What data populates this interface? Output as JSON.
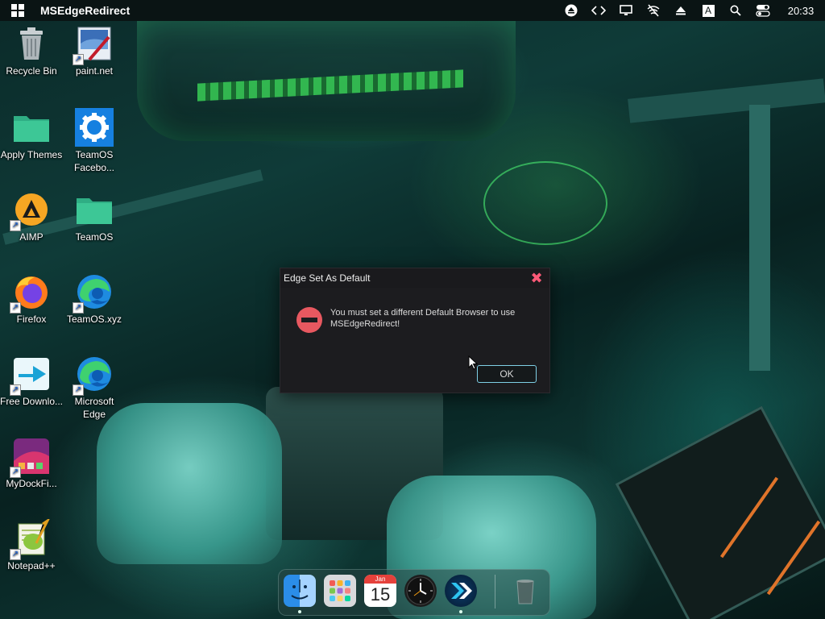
{
  "topbar": {
    "title": "MSEdgeRedirect",
    "clock": "20:33",
    "tray_icons": [
      "eject-circle-icon",
      "code-brackets-icon",
      "monitor-icon",
      "wifi-off-icon",
      "eject-icon",
      "keyboard-layout-icon",
      "search-icon",
      "toggle-icon"
    ],
    "keyboard_letter": "A"
  },
  "desktop": {
    "icons": [
      {
        "label": "Recycle Bin",
        "icon": "recycle-bin-icon"
      },
      {
        "label": "paint.net",
        "icon": "paintnet-icon"
      },
      {
        "label": "Apply Themes",
        "icon": "folder-icon"
      },
      {
        "label": "TeamOS Facebo...",
        "icon": "gear-icon"
      },
      {
        "label": "AIMP",
        "icon": "aimp-icon"
      },
      {
        "label": "TeamOS",
        "icon": "folder-icon"
      },
      {
        "label": "Firefox",
        "icon": "firefox-icon"
      },
      {
        "label": "TeamOS.xyz",
        "icon": "edge-icon"
      },
      {
        "label": "Free Downlo...",
        "icon": "download-arrow-icon"
      },
      {
        "label": "Microsoft Edge",
        "icon": "edge-icon"
      },
      {
        "label": "MyDockFi...",
        "icon": "mydock-icon"
      },
      {
        "label": "Notepad++",
        "icon": "notepadpp-icon"
      }
    ]
  },
  "dialog": {
    "title": "Edge Set As Default",
    "message": "You must set a different Default Browser to use MSEdgeRedirect!",
    "ok_label": "OK",
    "close_glyph": "✖"
  },
  "dock": {
    "calendar_month": "Jan",
    "calendar_day": "15",
    "items": [
      "finder-icon",
      "launchpad-icon",
      "calendar-icon",
      "clock-icon",
      "teamos-app-icon",
      "trash-icon"
    ]
  }
}
